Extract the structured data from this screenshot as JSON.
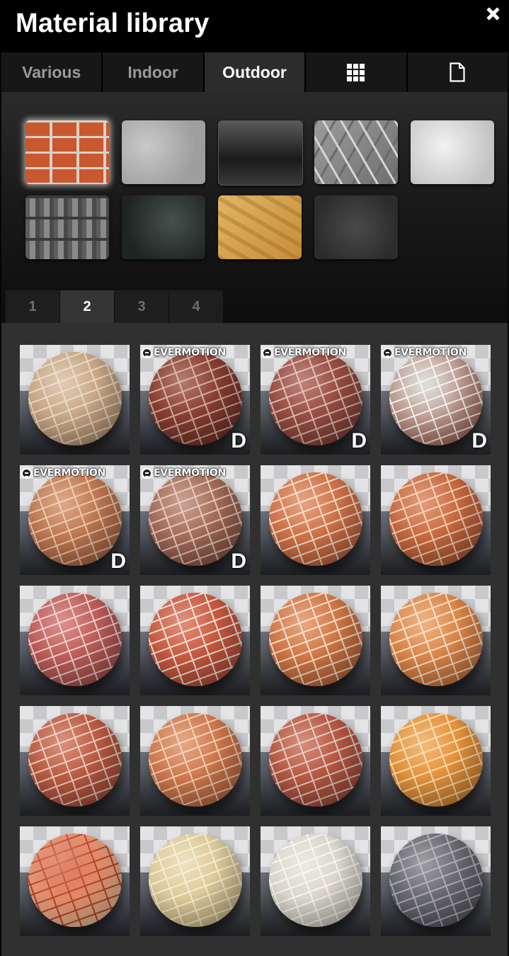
{
  "header": {
    "title": "Material library"
  },
  "tabs": [
    {
      "label": "Various",
      "active": false
    },
    {
      "label": "Indoor",
      "active": false
    },
    {
      "label": "Outdoor",
      "active": true
    },
    {
      "label": "",
      "icon": "grid-icon",
      "active": false
    },
    {
      "label": "",
      "icon": "document-icon",
      "active": false
    }
  ],
  "textures": [
    {
      "name": "red-brick-wall",
      "selected": true
    },
    {
      "name": "concrete"
    },
    {
      "name": "dark-glass"
    },
    {
      "name": "diamond-plate-metal"
    },
    {
      "name": "white-plaster"
    },
    {
      "name": "roof-tiles"
    },
    {
      "name": "dark-granite"
    },
    {
      "name": "osb-wood"
    },
    {
      "name": "asphalt"
    }
  ],
  "pages": [
    {
      "label": "1",
      "active": false
    },
    {
      "label": "2",
      "active": true
    },
    {
      "label": "3",
      "active": false
    },
    {
      "label": "4",
      "active": false
    }
  ],
  "brand_label": "EVERMOTION",
  "download_mark": "D",
  "materials": [
    {
      "tone": "beige-brick",
      "brand": false,
      "download": false
    },
    {
      "tone": "dark-red-brick",
      "brand": true,
      "download": true
    },
    {
      "tone": "weathered-red-brick",
      "brand": true,
      "download": true
    },
    {
      "tone": "white-painted-brick",
      "brand": true,
      "download": true
    },
    {
      "tone": "orange-brick",
      "brand": true,
      "download": true
    },
    {
      "tone": "mottled-brick",
      "brand": true,
      "download": true
    },
    {
      "tone": "orange-brick-light-mortar",
      "brand": false,
      "download": false
    },
    {
      "tone": "orange-brick-rough",
      "brand": false,
      "download": false
    },
    {
      "tone": "pink-red-brick",
      "brand": false,
      "download": false
    },
    {
      "tone": "red-brick-white-mortar",
      "brand": false,
      "download": false
    },
    {
      "tone": "orange-brick-white-mortar",
      "brand": false,
      "download": false
    },
    {
      "tone": "orange-brick-bright",
      "brand": false,
      "download": false
    },
    {
      "tone": "mixed-red-brick",
      "brand": false,
      "download": false
    },
    {
      "tone": "orange-brick-soft",
      "brand": false,
      "download": false
    },
    {
      "tone": "red-brick-grey-mortar",
      "brand": false,
      "download": false
    },
    {
      "tone": "yellow-orange-brick",
      "brand": false,
      "download": false
    },
    {
      "tone": "striped-red-cream-brick",
      "brand": false,
      "download": false
    },
    {
      "tone": "cream-stone-brick",
      "brand": false,
      "download": false
    },
    {
      "tone": "white-plaster-tiles",
      "brand": false,
      "download": false
    },
    {
      "tone": "grey-granite-tiles",
      "brand": false,
      "download": false
    }
  ]
}
